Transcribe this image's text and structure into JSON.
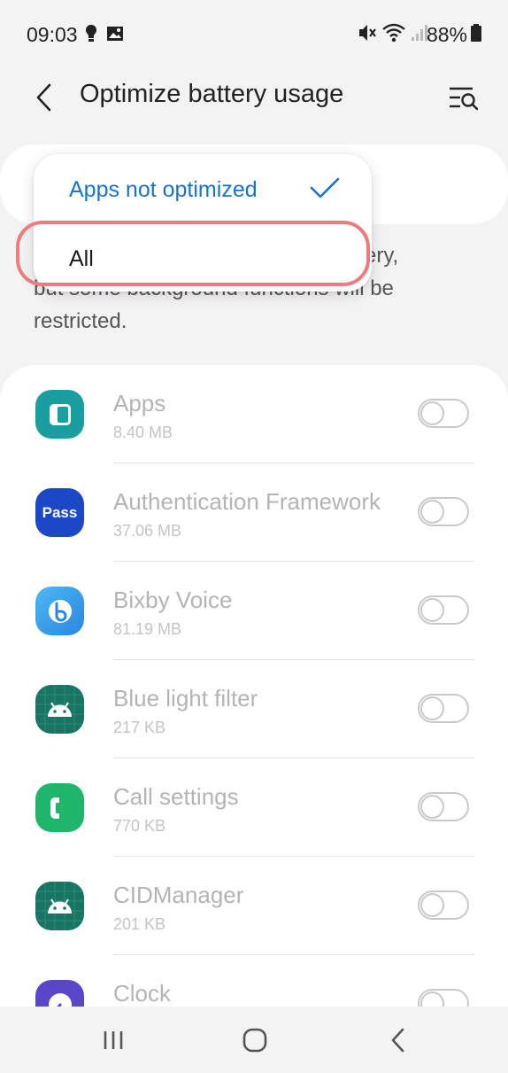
{
  "status_bar": {
    "time": "09:03",
    "battery": "88%",
    "left_icons": [
      "bulb-icon",
      "image-icon"
    ],
    "right_icons": [
      "mute-icon",
      "wifi-icon",
      "signal-icon"
    ]
  },
  "header": {
    "title": "Optimize battery usage",
    "back_icon": "back-arrow-icon",
    "search_icon": "search-filter-icon"
  },
  "dropdown": {
    "options": [
      {
        "label": "Apps not optimized",
        "selected": true
      },
      {
        "label": "All",
        "selected": false
      }
    ]
  },
  "description": "...ery, but some background functions will be restricted.",
  "description_lines": {
    "line1": "ery,",
    "line2": "but some background functions will be",
    "line3": "restricted."
  },
  "apps": [
    {
      "name": "Apps",
      "size": "8.40 MB",
      "icon": "apps-icon",
      "color": "#1a9ea0",
      "enabled": false
    },
    {
      "name": "Authentication Framework",
      "size": "37.06 MB",
      "icon": "pass-icon",
      "color": "#1c47c7",
      "enabled": false
    },
    {
      "name": "Bixby Voice",
      "size": "81.19 MB",
      "icon": "bixby-icon",
      "color": "#3aa6ee",
      "enabled": false
    },
    {
      "name": "Blue light filter",
      "size": "217 KB",
      "icon": "android-icon",
      "color": "#187563",
      "enabled": false
    },
    {
      "name": "Call settings",
      "size": "770 KB",
      "icon": "phone-icon",
      "color": "#1fb66a",
      "enabled": false
    },
    {
      "name": "CIDManager",
      "size": "201 KB",
      "icon": "android-icon",
      "color": "#187563",
      "enabled": false
    },
    {
      "name": "Clock",
      "size": "",
      "icon": "clock-icon",
      "color": "#5848c9",
      "enabled": false
    }
  ],
  "pass_text": "Pass",
  "nav": [
    "recents-icon",
    "home-icon",
    "back-icon"
  ],
  "colors": {
    "accent": "#1a73c9",
    "highlight": "#f07b7e",
    "background": "#f3f3f3"
  }
}
